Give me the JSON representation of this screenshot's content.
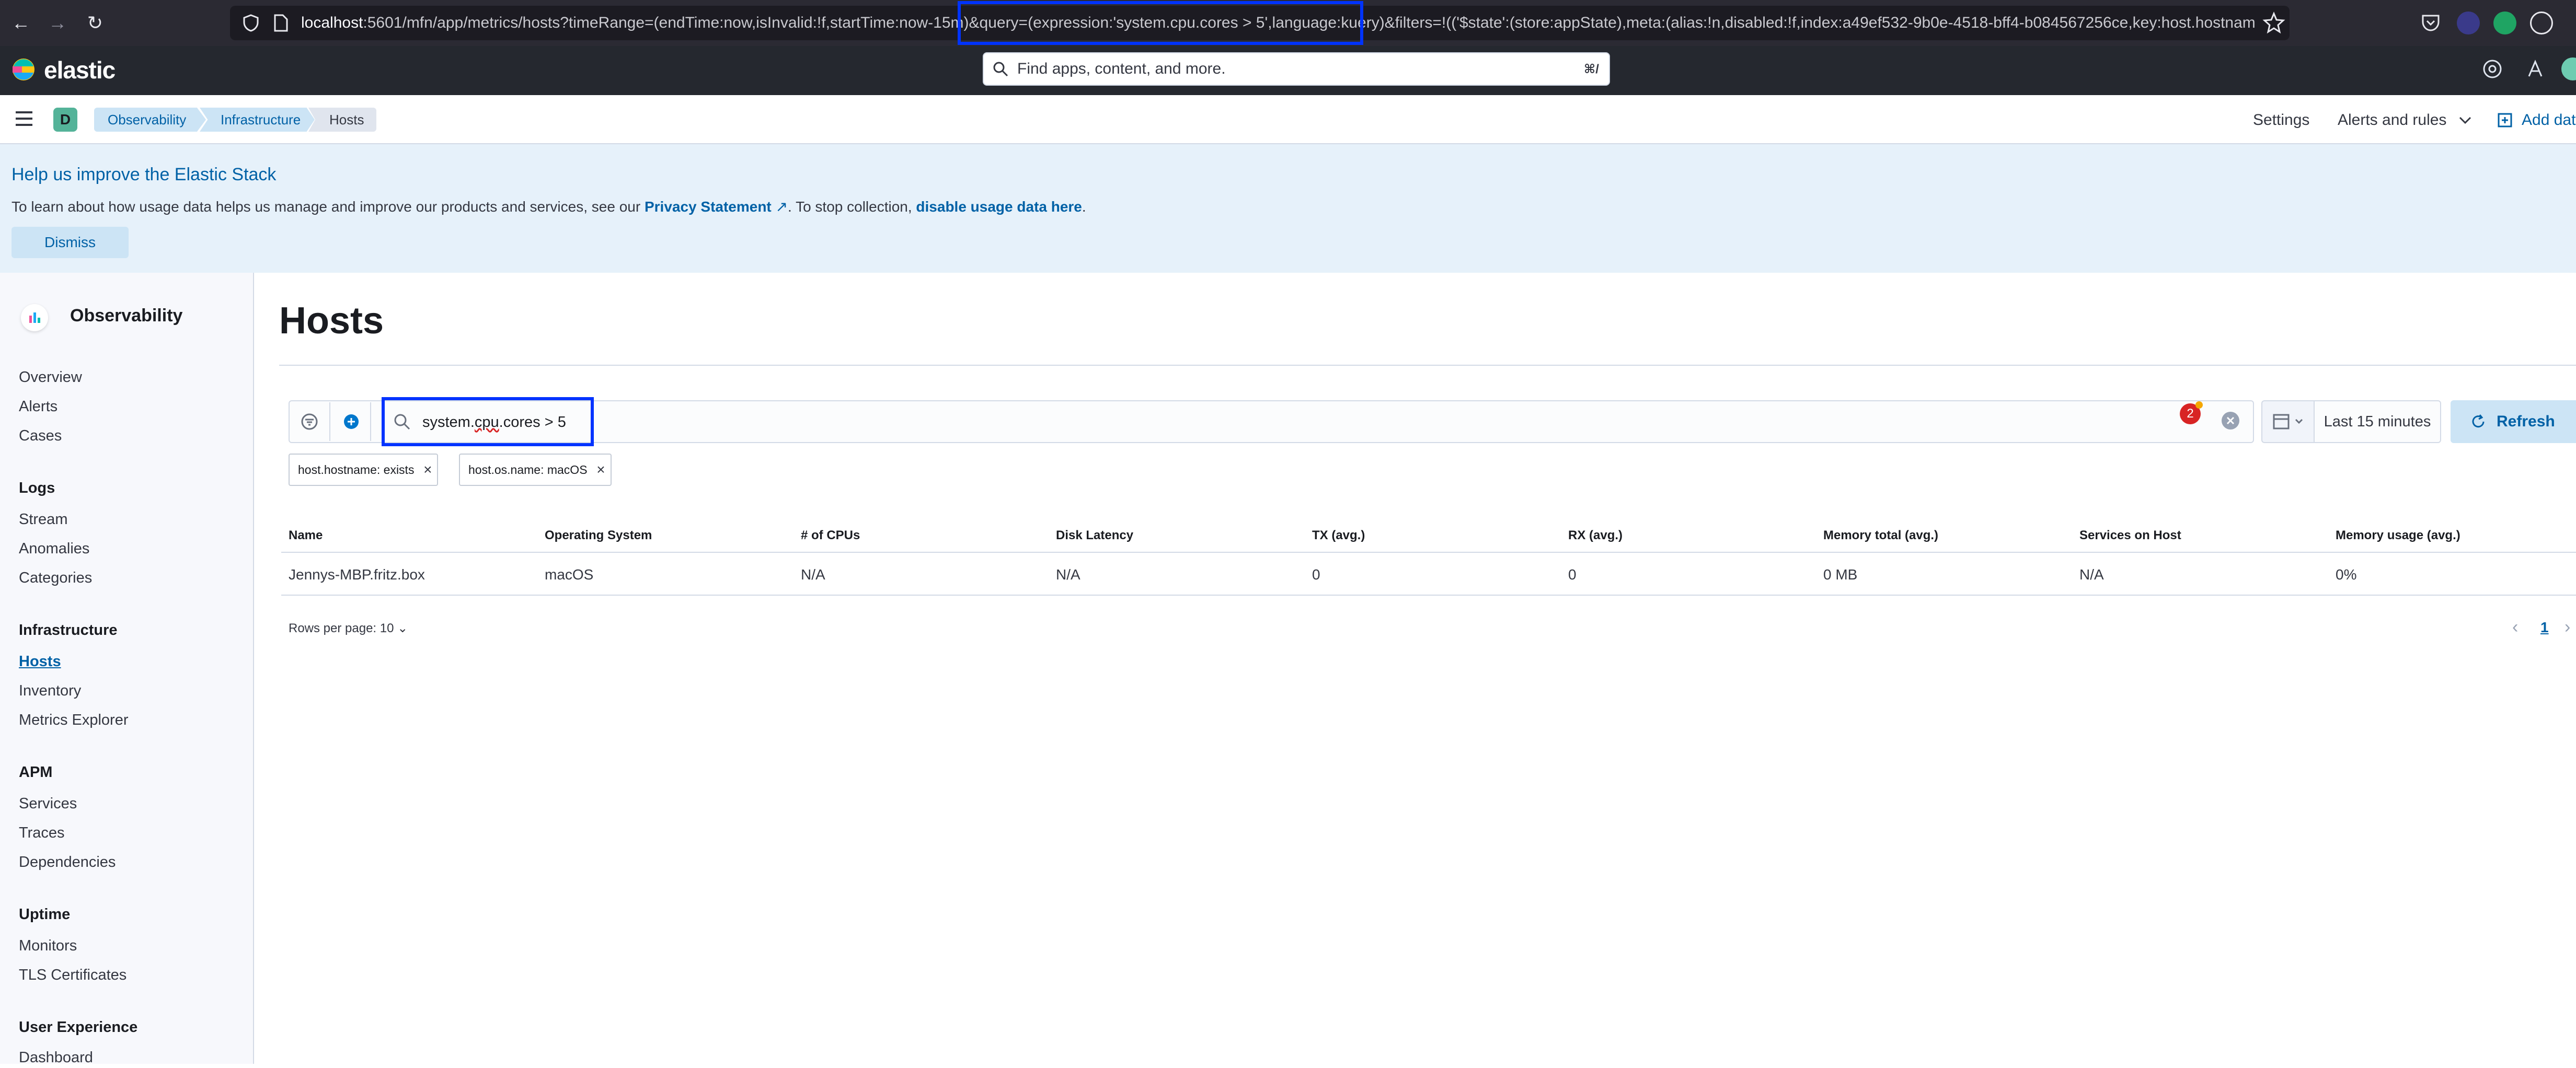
{
  "browser": {
    "url_host": "localhost",
    "url_rest": ":5601/mfn/app/metrics/hosts?timeRange=(endTime:now,isInvalid:!f,startTime:now-15m)&query=(expression:'system.cpu.cores > 5',language:kuery)&filters=!(('$state':(store:appState),meta:(alias:!n,disabled:!f,index:a49ef532-9b0e-4518-bff4-b084567256ce,key:host.hostname,n"
  },
  "header": {
    "logo_text": "elastic",
    "search_placeholder": "Find apps, content, and more.",
    "search_shortcut": "⌘/",
    "space_initial": "D",
    "breadcrumbs": [
      "Observability",
      "Infrastructure",
      "Hosts"
    ],
    "settings_label": "Settings",
    "alerts_label": "Alerts and rules",
    "add_data_label": "Add dat"
  },
  "banner": {
    "title": "Help us improve the Elastic Stack",
    "text_before": "To learn about how usage data helps us manage and improve our products and services, see our ",
    "privacy_link": "Privacy Statement",
    "text_middle": ". To stop collection, ",
    "disable_link": "disable usage data here",
    "text_after": ".",
    "dismiss_label": "Dismiss"
  },
  "sidenav": {
    "title": "Observability",
    "sections": [
      {
        "heading": "",
        "items": [
          "Overview",
          "Alerts",
          "Cases"
        ]
      },
      {
        "heading": "Logs",
        "items": [
          "Stream",
          "Anomalies",
          "Categories"
        ]
      },
      {
        "heading": "Infrastructure",
        "items": [
          "Hosts",
          "Inventory",
          "Metrics Explorer"
        ]
      },
      {
        "heading": "APM",
        "items": [
          "Services",
          "Traces",
          "Dependencies"
        ]
      },
      {
        "heading": "Uptime",
        "items": [
          "Monitors",
          "TLS Certificates"
        ]
      },
      {
        "heading": "User Experience",
        "items": [
          "Dashboard"
        ]
      }
    ],
    "active_item": "Hosts"
  },
  "main": {
    "title": "Hosts",
    "query_part1": "system.",
    "query_part2": "cpu",
    "query_part3": ".cores > 5",
    "error_count": "2",
    "date_range": "Last 15 minutes",
    "refresh_label": "Refresh",
    "filters": [
      "host.hostname: exists",
      "host.os.name: macOS"
    ],
    "table": {
      "columns": [
        "Name",
        "Operating System",
        "# of CPUs",
        "Disk Latency",
        "TX (avg.)",
        "RX (avg.)",
        "Memory total (avg.)",
        "Services on Host",
        "Memory usage (avg.)"
      ],
      "rows": [
        [
          "Jennys-MBP.fritz.box",
          "macOS",
          "N/A",
          "N/A",
          "0",
          "0",
          "0 MB",
          "N/A",
          "0%"
        ]
      ]
    },
    "rows_per_page": "Rows per page: 10",
    "current_page": "1"
  },
  "colors": {
    "accent": "#0061a6",
    "highlight": "#0033ff",
    "header_bg": "#25282f",
    "banner_bg": "#e6f1fa"
  }
}
